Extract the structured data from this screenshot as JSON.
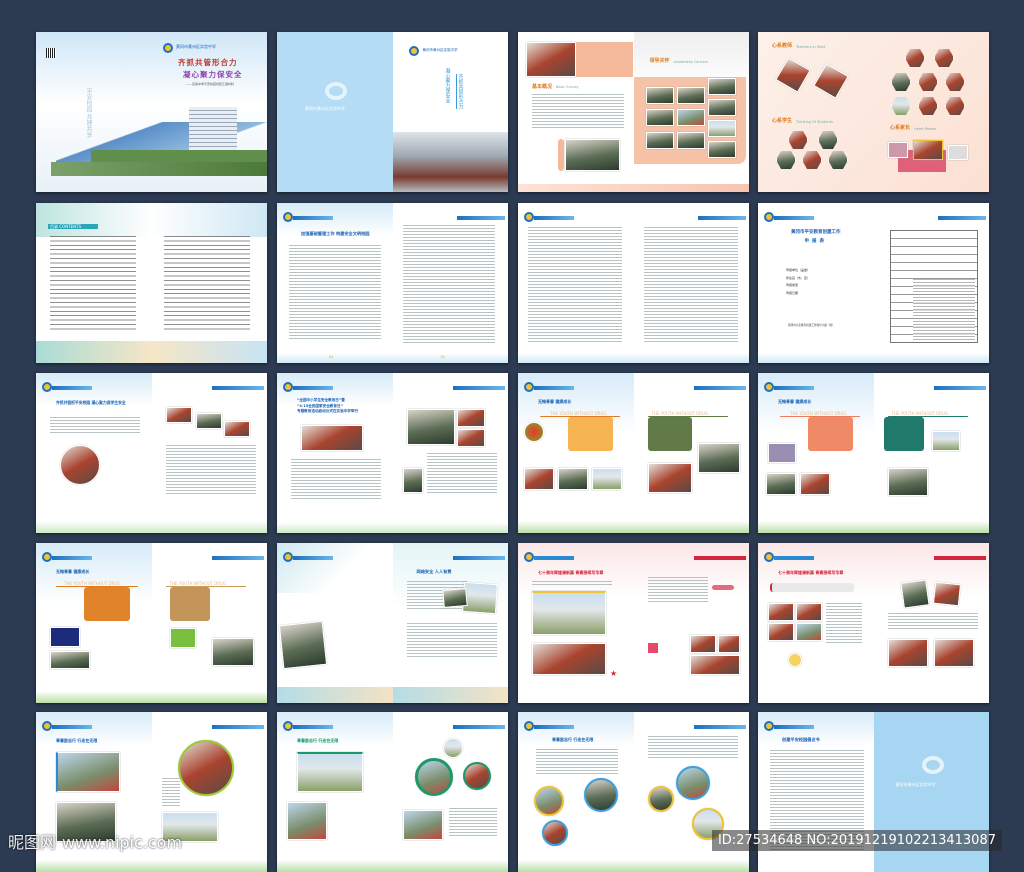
{
  "school_name": "黄冈市黄州区实验中学",
  "cover": {
    "title_line1": "齐抓共管形合力",
    "title_line2": "凝心聚力保安全",
    "subtitle": "——实验中学平安校园创建汇报材料",
    "calligraphy": "平安校园 共建共享"
  },
  "inner_cover": {
    "title_line1": "齐抓共管形合力",
    "title_line2": "凝心聚力保安全"
  },
  "spread3": {
    "left_title": "基本概况",
    "left_en": "Basic Survey",
    "right_title": "领导关怀",
    "right_en": "Leadership Concern"
  },
  "spread4": {
    "t1": "心系教师",
    "t1_en": "Teachers In Mind",
    "t2": "心系学生",
    "t2_en": "Thinking Of Students",
    "t3": "心系家长",
    "t3_en": "Heart Parent"
  },
  "contents": {
    "title": "目录",
    "title_en": "CONTENTS"
  },
  "article1": {
    "title": "加强基础管理工作 构建安全文明校园"
  },
  "form": {
    "title": "黄冈市平安教育创建工作",
    "subtitle": "申报表",
    "fields": [
      "申报单位（盖章）",
      "所在县（市、区）",
      "申报类型",
      "申报日期"
    ],
    "footer": "黄冈市平安教育创建工作领导小组（制）"
  },
  "safety": {
    "title": "齐抓共管抓平安校园 凝心聚力保学生安全"
  },
  "event": {
    "title_line1": "“全国中小学生安全教育日”暨",
    "title_line2": "“4·15全民国家安全教育日”",
    "title_line3": "专题教育活动启动仪式在实验中学举行"
  },
  "youth": {
    "title": "无悔青春 健康成长",
    "tagline": "THE YOUTH WITHOUT DRUG"
  },
  "network": {
    "title": "网络安全 人人有责"
  },
  "anniversary": {
    "title": "七十周年辉煌谱新篇 青春接续写华章"
  },
  "march": {
    "title": "青春励志行 行走在无限"
  },
  "proposal": {
    "title": "创建平安校园倡议书"
  },
  "watermark": {
    "site": "昵图网",
    "url": "www.nipic.com",
    "id": "ID:27534648 NO:20191219102213413087"
  },
  "colors": {
    "background": "#2c3a52",
    "brand_blue": "#1f6fc0",
    "accent_orange": "#e07c1e",
    "accent_red": "#d2263e"
  }
}
